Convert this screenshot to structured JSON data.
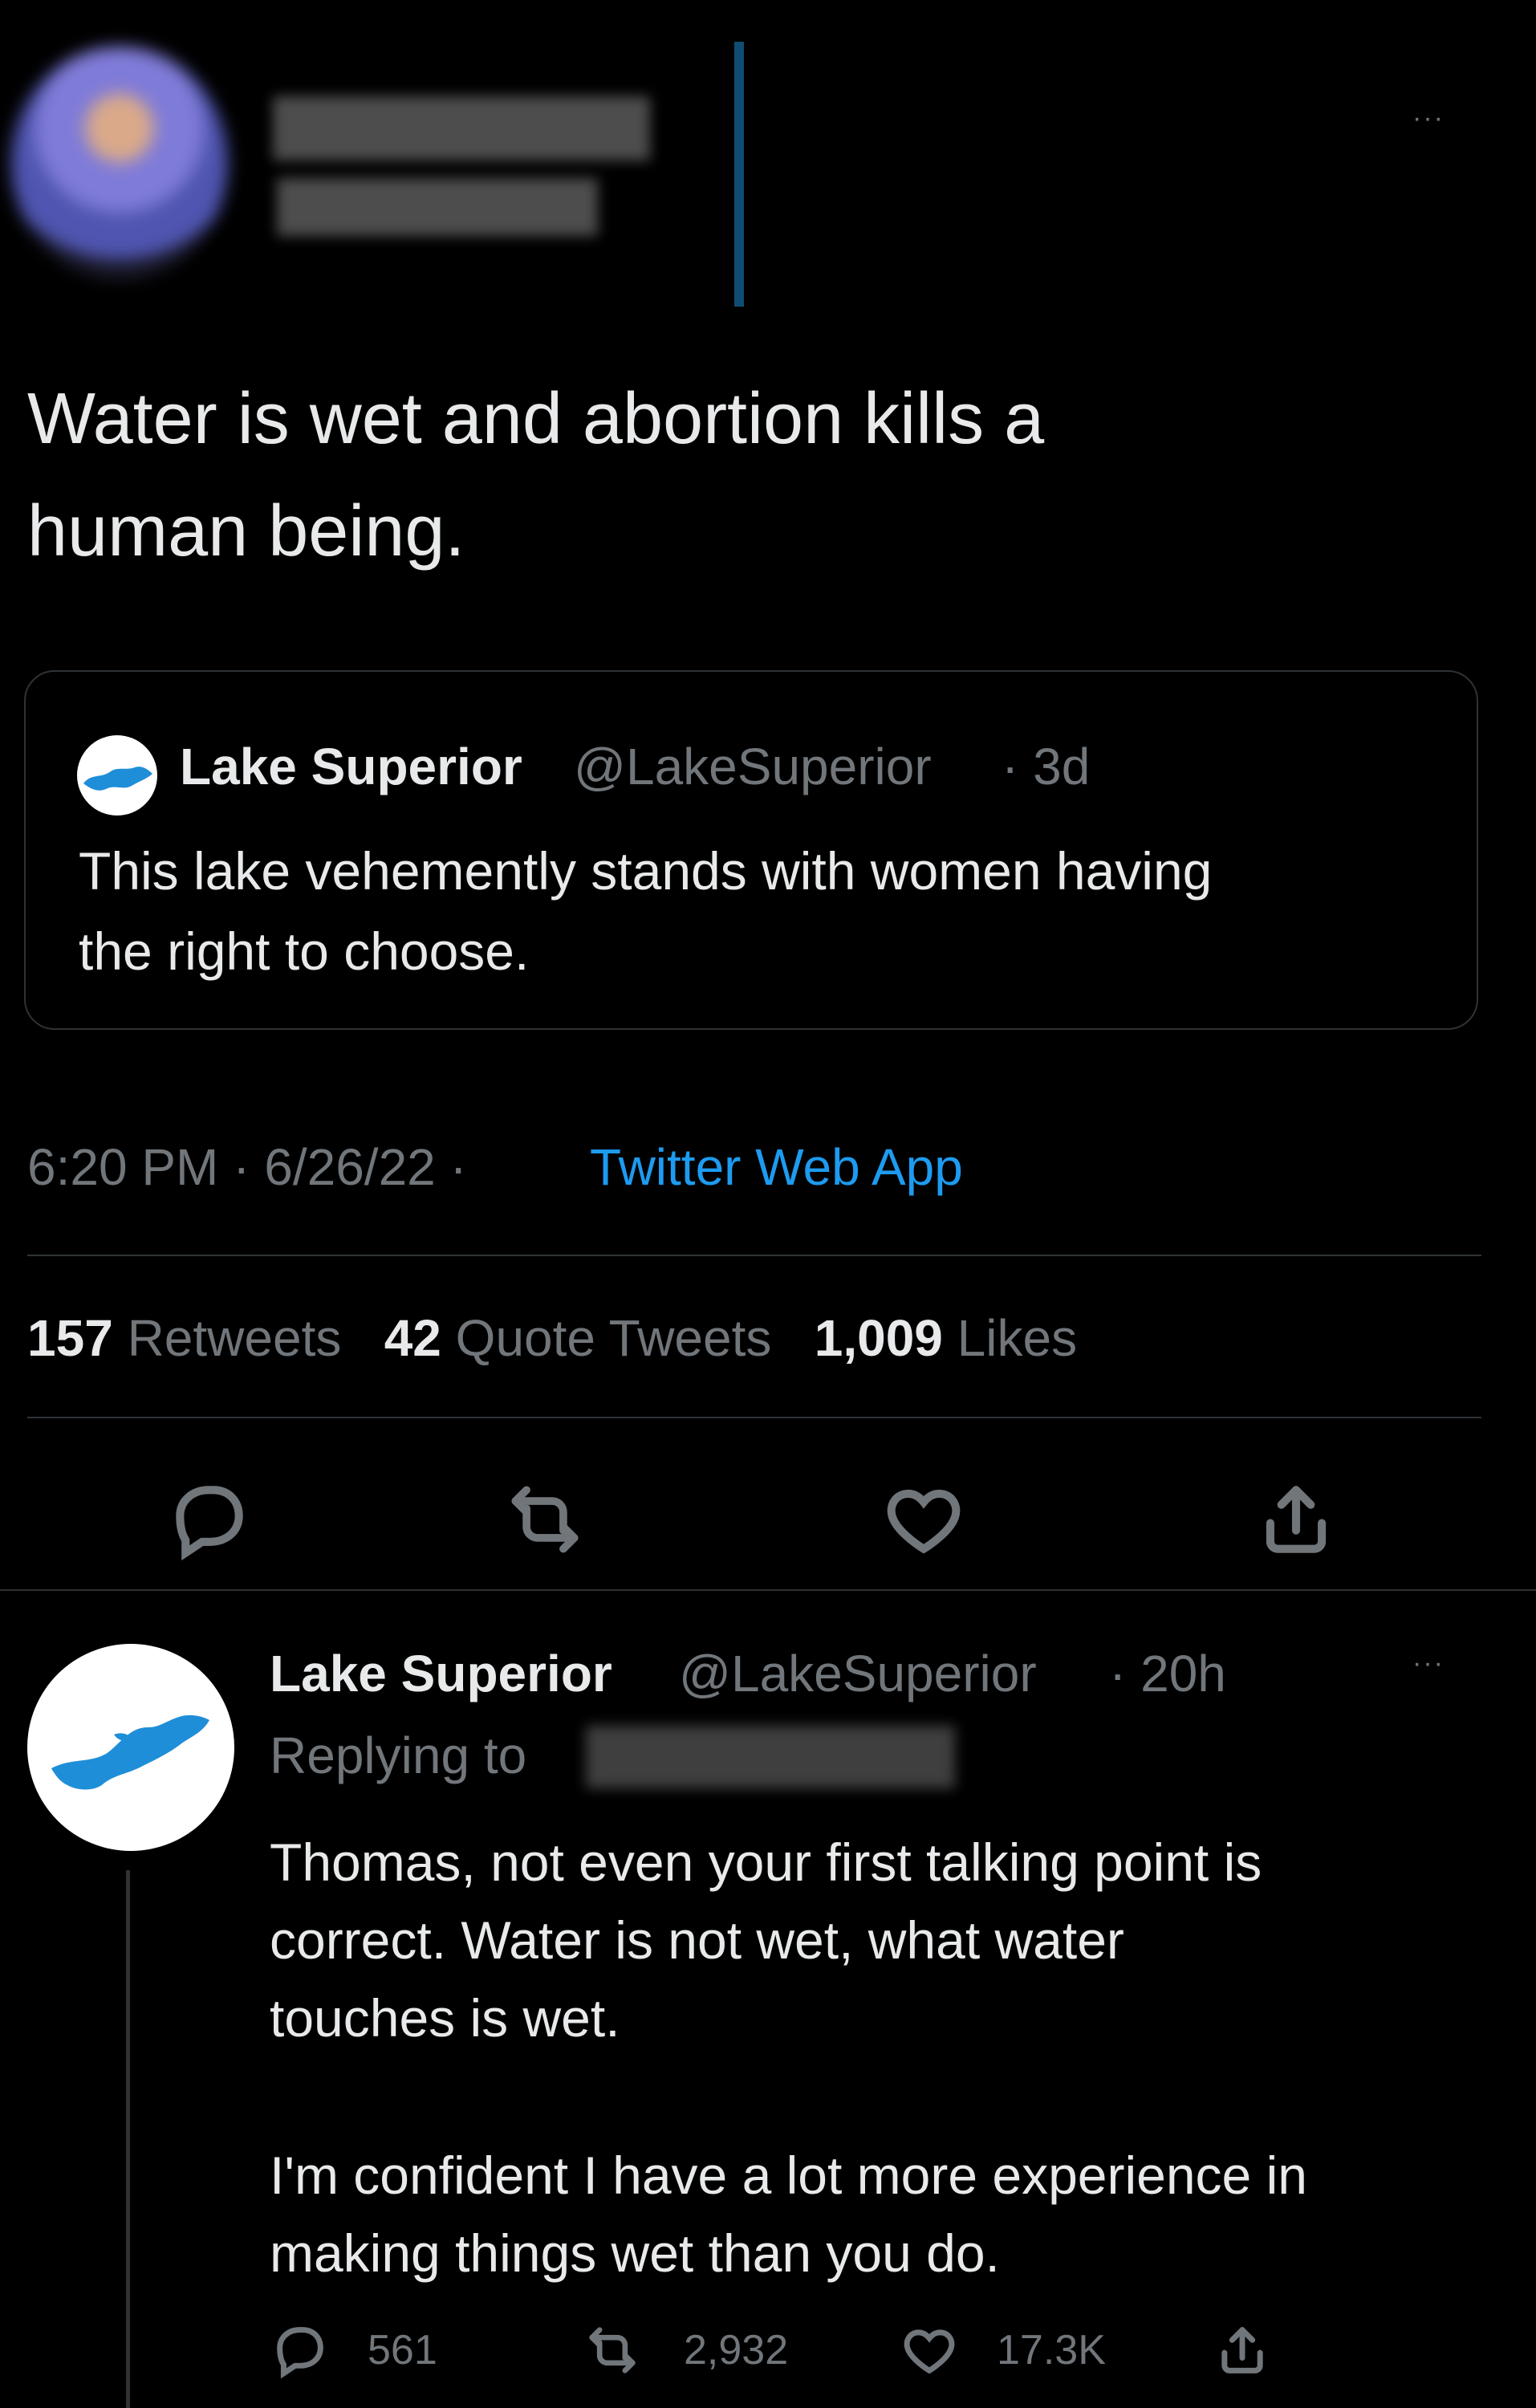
{
  "main_tweet": {
    "text_line1": "Water is wet and abortion kills a",
    "text_line2": "human being.",
    "more_label": "···",
    "quoted_tweet": {
      "author": "Lake Superior",
      "handle": "@LakeSuperior",
      "time": "· 3d",
      "text_line1": "This lake vehemently stands with women having",
      "text_line2": "the right to choose."
    },
    "timestamp": "6:20 PM · 6/26/22 ·",
    "source": "Twitter Web App",
    "stats": {
      "retweets_count": "157",
      "retweets_label": "Retweets",
      "quotes_count": "42",
      "quotes_label": "Quote Tweets",
      "likes_count": "1,009",
      "likes_label": "Likes"
    }
  },
  "reply": {
    "author": "Lake Superior",
    "handle": "@LakeSuperior",
    "time": "· 20h",
    "more_label": "···",
    "replying_to_label": "Replying to",
    "lines": [
      "Thomas, not even your first talking point is",
      "correct. Water is not wet, what water",
      "touches is wet.",
      "I'm confident I have a lot more experience in",
      "making things wet than you do."
    ],
    "actions": {
      "reply_count": "561",
      "retweet_count": "2,932",
      "like_count": "17.3K"
    }
  },
  "colors": {
    "background": "#000000",
    "text": "#e7e9ea",
    "muted": "#71767b",
    "link": "#1d9bf0",
    "border": "#2f3336",
    "lake_blue": "#1f8ed8"
  },
  "icons": {
    "reply": "reply-icon",
    "retweet": "retweet-icon",
    "like": "heart-icon",
    "share": "share-icon"
  }
}
